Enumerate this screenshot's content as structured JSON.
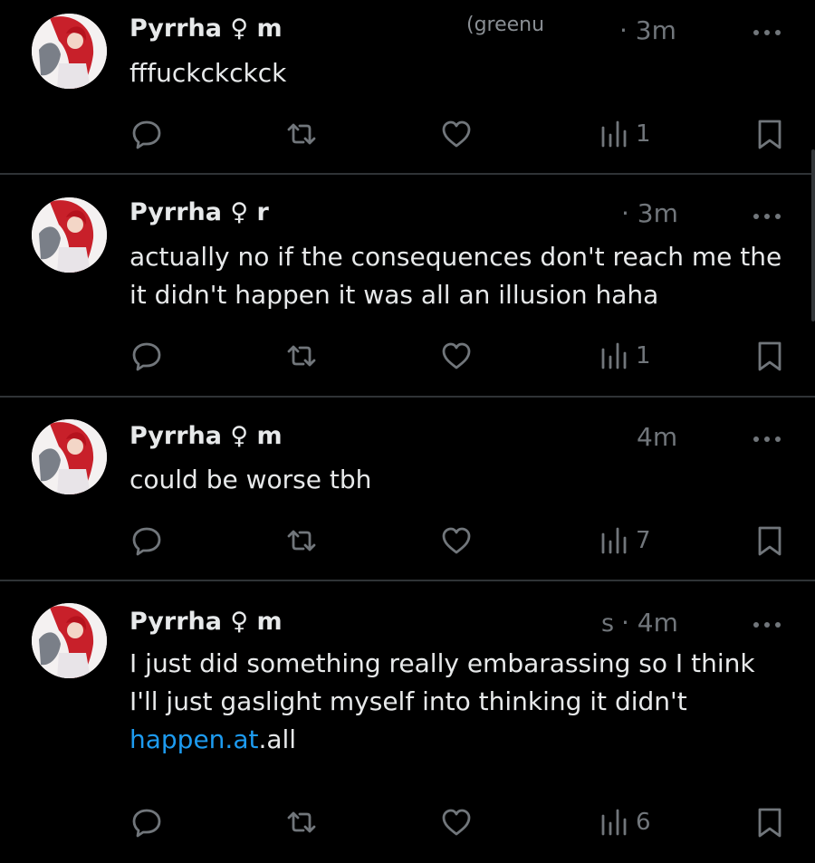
{
  "posts": [
    {
      "author": "Pyrrha ♀ m",
      "handle_fragment": "(greenu",
      "time": "· 3m",
      "text": "fffuckckckck",
      "link": "",
      "views": "1"
    },
    {
      "author": "Pyrrha ♀ r",
      "handle_fragment": "",
      "time": "· 3m",
      "text": "actually no if the consequences don't reach me the it didn't happen it was all an illusion haha",
      "link": "",
      "views": "1"
    },
    {
      "author": "Pyrrha ♀ m",
      "handle_fragment": "",
      "time": "4m",
      "text": "could be worse tbh",
      "link": "",
      "views": "7"
    },
    {
      "author": "Pyrrha ♀ m",
      "handle_fragment": "s",
      "time": "· 4m",
      "text": "I just did something really embarassing so I think I'll just gaslight myself into thinking it didn't ",
      "link": "happen.at",
      "text_after_link": ".all",
      "views": "6"
    }
  ],
  "icons": {
    "reply": "reply-icon",
    "repost": "repost-icon",
    "like": "heart-icon",
    "views": "views-icon",
    "bookmark": "bookmark-icon",
    "more": "more-icon"
  },
  "colors": {
    "background": "#000000",
    "text": "#e7e9ea",
    "muted": "#71767b",
    "link": "#1d9bf0",
    "divider": "#2f3336"
  }
}
